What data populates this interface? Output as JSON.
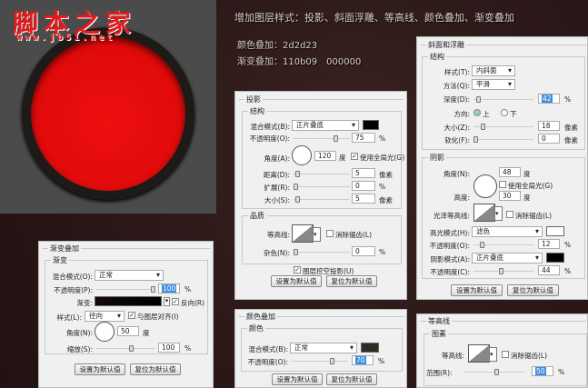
{
  "logo": {
    "text": "脚本之家",
    "url": "www.jb51.net"
  },
  "notes": {
    "title": "增加图层样式：投影、斜面浮雕、等高线、颜色叠加、渐变叠加",
    "color_overlay": "颜色叠加：2d2d23",
    "gradient_overlay": "渐变叠加：110b09　000000"
  },
  "colors": {
    "red": "#e00a0a",
    "overlay": "#2d2d23",
    "grad_a": "#110b09",
    "grad_b": "#000000"
  },
  "drop_shadow": {
    "title": "投影",
    "structure": "结构",
    "blend_label": "混合模式(B):",
    "blend": "正片叠底",
    "opacity_label": "不透明度(O):",
    "opacity": "75",
    "pct": "%",
    "angle_label": "角度(A):",
    "angle": "120",
    "deg": "度",
    "global_light": "使用全局光(G)",
    "distance_label": "距离(D):",
    "distance": "5",
    "px": "像素",
    "spread_label": "扩展(R):",
    "spread": "0",
    "size_label": "大小(S):",
    "size": "5",
    "quality": "品质",
    "contour_label": "等高线:",
    "anti_alias": "消除锯齿(L)",
    "noise_label": "杂色(N):",
    "noise": "0",
    "knockout": "图层挖空投影(U)",
    "btn_default": "设置为默认值",
    "btn_reset": "复位为默认值"
  },
  "bevel": {
    "title": "斜面和浮雕",
    "structure": "结构",
    "style_label": "样式(T):",
    "style": "内斜面",
    "technique_label": "方法(Q):",
    "technique": "平滑",
    "depth_label": "深度(D):",
    "depth": "42",
    "pct": "%",
    "direction_label": "方向:",
    "up": "上",
    "down": "下",
    "size_label": "大小(Z):",
    "size": "18",
    "px": "像素",
    "soften_label": "软化(F):",
    "soften": "0",
    "shading": "阴影",
    "angle_label": "角度(N):",
    "angle": "48",
    "deg": "度",
    "global_light": "使用全局光(G)",
    "altitude_label": "高度:",
    "altitude": "30",
    "gloss_label": "光泽等高线:",
    "anti_alias": "消除锯齿(L)",
    "highlight_label": "高光模式(H):",
    "highlight": "滤色",
    "hl_opacity_label": "不透明度(O):",
    "hl_opacity": "12",
    "shadow_label": "阴影模式(A):",
    "shadow": "正片叠底",
    "sh_opacity_label": "不透明度(C):",
    "sh_opacity": "44",
    "btn_default": "设置为默认值",
    "btn_reset": "复位为默认值"
  },
  "gradient": {
    "title": "渐变叠加",
    "group": "渐变",
    "blend_label": "混合模式(O):",
    "blend": "正常",
    "opacity_label": "不透明度(P):",
    "opacity": "100",
    "pct": "%",
    "gradient_label": "渐变:",
    "reverse": "反向(R)",
    "style_label": "样式(L):",
    "style": "径向",
    "align": "与图层对齐(I)",
    "angle_label": "角度(N):",
    "angle": "50",
    "deg": "度",
    "scale_label": "缩放(S):",
    "scale": "100",
    "btn_default": "设置为默认值",
    "btn_reset": "复位为默认值"
  },
  "color_overlay": {
    "title": "颜色叠加",
    "group": "颜色",
    "blend_label": "混合模式(B):",
    "blend": "正常",
    "opacity_label": "不透明度(O):",
    "opacity": "70",
    "pct": "%",
    "btn_default": "设置为默认值",
    "btn_reset": "复位为默认值"
  },
  "contour": {
    "title": "等高线",
    "group": "图素",
    "contour_label": "等高线:",
    "anti_alias": "消除锯齿(L)",
    "range_label": "范围(R):",
    "range": "50",
    "pct": "%"
  }
}
